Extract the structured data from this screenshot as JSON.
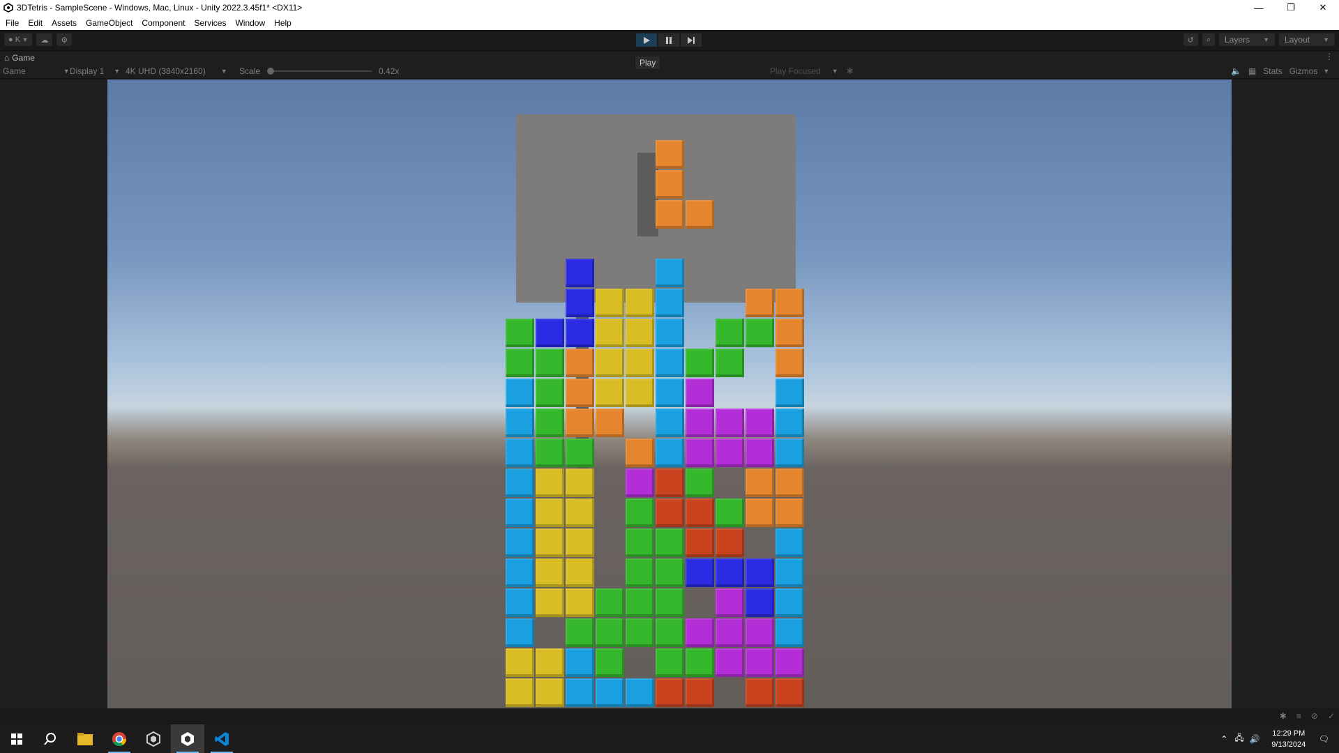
{
  "window": {
    "title": "3DTetris - SampleScene - Windows, Mac, Linux - Unity 2022.3.45f1* <DX11>",
    "minimize": "—",
    "restore": "❐",
    "close": "✕"
  },
  "menu": [
    "File",
    "Edit",
    "Assets",
    "GameObject",
    "Component",
    "Services",
    "Window",
    "Help"
  ],
  "toolbar": {
    "account": "K",
    "layers_label": "Layers",
    "layout_label": "Layout",
    "play_tooltip": "Play"
  },
  "game_tab": {
    "label": "Game"
  },
  "game_bar": {
    "view_mode": "Game",
    "display": "Display 1",
    "resolution": "4K UHD (3840x2160)",
    "scale_label": "Scale",
    "scale_value": "0.42x",
    "play_mode": "Play Focused",
    "stats": "Stats",
    "gizmos": "Gizmos"
  },
  "colors": {
    "cyan": "#1aa0e0",
    "yellow": "#d8bd24",
    "orange": "#e5852e",
    "green": "#35b82c",
    "blue": "#2a2be2",
    "purple": "#b32ed6",
    "red": "#c8431e"
  },
  "game_board": {
    "columns": 10,
    "cells_by_row_top_to_bottom": [
      [
        "",
        "",
        "",
        "",
        "",
        "",
        "",
        "",
        "",
        ""
      ],
      [
        "",
        "",
        "",
        "",
        "",
        "",
        "",
        "",
        "",
        ""
      ],
      [
        "",
        "",
        "",
        "",
        "",
        "",
        "",
        "",
        "",
        ""
      ],
      [
        "",
        "",
        "",
        "",
        "",
        "",
        "",
        "",
        "",
        ""
      ],
      [
        "",
        "",
        "",
        "",
        "",
        "",
        "",
        "",
        "",
        ""
      ],
      [
        "",
        "",
        "",
        "",
        "",
        "",
        "",
        "",
        "",
        ""
      ],
      [
        "",
        "",
        "",
        "",
        "",
        "",
        "",
        "",
        "",
        ""
      ],
      [
        "",
        "",
        "",
        "",
        "",
        "",
        "",
        "",
        "",
        ""
      ],
      [
        "",
        "",
        "",
        "",
        "",
        "",
        "",
        "",
        "",
        ""
      ],
      [
        "",
        "",
        "",
        "",
        "",
        "",
        "",
        "",
        "",
        ""
      ],
      [
        "",
        "",
        "",
        "",
        "",
        "",
        "",
        "",
        "",
        ""
      ],
      [
        "",
        "",
        "",
        "",
        "",
        "",
        "",
        "",
        "",
        ""
      ],
      [
        "",
        "",
        "",
        "",
        "",
        "",
        "",
        "",
        "",
        ""
      ],
      [
        "",
        "",
        "",
        "",
        "",
        "",
        "",
        "",
        "",
        ""
      ],
      [
        "",
        "",
        "",
        "",
        "",
        "",
        "",
        "",
        "",
        ""
      ],
      [
        "",
        "",
        "",
        "",
        "",
        "",
        "",
        "",
        "",
        ""
      ],
      [
        "",
        "",
        "",
        "",
        "",
        "",
        "",
        "",
        "",
        ""
      ],
      [
        "",
        "",
        "",
        "",
        "",
        "",
        "",
        "",
        "",
        ""
      ],
      [
        "",
        "",
        "",
        "",
        "",
        "",
        "",
        "",
        "",
        ""
      ],
      [
        "",
        "",
        "",
        "",
        "",
        "",
        "",
        "",
        "",
        ""
      ]
    ],
    "stack": [
      [
        "",
        "",
        "blue",
        "",
        "",
        "cyan",
        "",
        "",
        "",
        ""
      ],
      [
        "",
        "",
        "blue",
        "yellow",
        "yellow",
        "cyan",
        "",
        "",
        "orange",
        "orange"
      ],
      [
        "green",
        "blue",
        "blue",
        "yellow",
        "yellow",
        "cyan",
        "",
        "green",
        "green",
        "orange"
      ],
      [
        "green",
        "green",
        "orange",
        "yellow",
        "yellow",
        "cyan",
        "green",
        "green",
        "",
        "orange"
      ],
      [
        "cyan",
        "green",
        "orange",
        "yellow",
        "yellow",
        "cyan",
        "purple",
        "",
        "",
        "cyan"
      ],
      [
        "cyan",
        "green",
        "orange",
        "orange",
        "",
        "cyan",
        "purple",
        "purple",
        "purple",
        "cyan"
      ],
      [
        "cyan",
        "green",
        "green",
        "",
        "orange",
        "cyan",
        "purple",
        "purple",
        "purple",
        "cyan"
      ],
      [
        "cyan",
        "yellow",
        "yellow",
        "",
        "purple",
        "red",
        "green",
        "",
        "orange",
        "orange"
      ],
      [
        "cyan",
        "yellow",
        "yellow",
        "",
        "green",
        "red",
        "red",
        "green",
        "orange",
        "orange"
      ],
      [
        "cyan",
        "yellow",
        "yellow",
        "",
        "green",
        "green",
        "red",
        "red",
        "",
        "cyan"
      ],
      [
        "cyan",
        "yellow",
        "yellow",
        "",
        "green",
        "green",
        "blue",
        "blue",
        "blue",
        "cyan"
      ],
      [
        "cyan",
        "yellow",
        "yellow",
        "green",
        "green",
        "green",
        "",
        "purple",
        "blue",
        "cyan"
      ],
      [
        "cyan",
        "",
        "green",
        "green",
        "green",
        "green",
        "purple",
        "purple",
        "purple",
        "cyan"
      ],
      [
        "yellow",
        "yellow",
        "cyan",
        "green",
        "",
        "green",
        "green",
        "purple",
        "purple",
        "purple"
      ],
      [
        "yellow",
        "yellow",
        "cyan",
        "cyan",
        "cyan",
        "red",
        "red",
        "",
        "red",
        "red"
      ]
    ],
    "falling_piece": {
      "color": "orange",
      "cells": [
        [
          5,
          0
        ],
        [
          5,
          1
        ],
        [
          5,
          2
        ],
        [
          6,
          2
        ]
      ]
    }
  },
  "taskbar": {
    "apps": [
      "start-icon",
      "search-icon",
      "file-explorer-icon",
      "chrome-icon",
      "unity-hub-icon",
      "unity-editor-icon",
      "vscode-icon"
    ],
    "time": "12:29 PM",
    "date": "9/13/2024"
  }
}
